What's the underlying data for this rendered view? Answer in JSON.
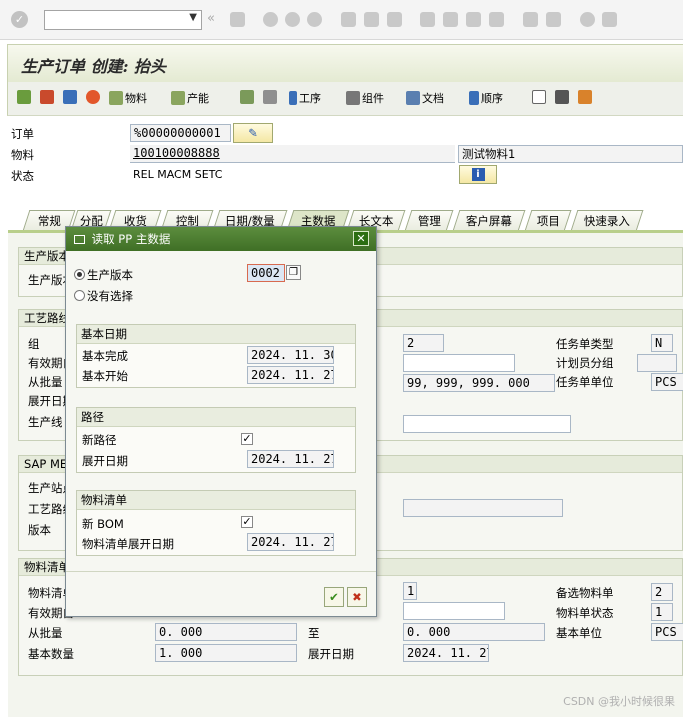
{
  "window": {
    "title": "生产订单 创建: 抬头"
  },
  "app_toolbar": {
    "material": "物料",
    "capacity": "产能",
    "operation": "工序",
    "component": "组件",
    "document": "文档",
    "sequence": "顺序"
  },
  "header": {
    "order_label": "订单",
    "order_value": "%00000000001",
    "material_label": "物料",
    "material_value": "100100008888",
    "material_desc": "测试物料1",
    "status_label": "状态",
    "status_value": "REL  MACM SETC"
  },
  "tabs": [
    "常规",
    "分配",
    "收货",
    "控制",
    "日期/数量",
    "主数据",
    "长文本",
    "管理",
    "客户屏幕",
    "项目",
    "快速录入"
  ],
  "active_tab": "主数据",
  "bg": {
    "g1_title": "生产版本",
    "g1_r1": "生产版本",
    "g2_title": "工艺路线",
    "g2_group": "组",
    "g2_valid": "有效期自",
    "g2_lot": "从批量",
    "g2_explode": "展开日期",
    "g2_prodline": "生产线",
    "g2_counter_value": "2",
    "g2_lot_to_value": "99, 999, 999. 000",
    "g2_tasklist_type": "任务单类型",
    "g2_tasklist_type_value": "N",
    "g2_planner_group": "计划员分组",
    "g2_tasklist_unit": "任务单单位",
    "g2_tasklist_unit_value": "PCS",
    "g3_title": "SAP ME",
    "g3_r1": "生产站点",
    "g3_r2": "工艺路线",
    "g3_r3": "版本",
    "g4_title": "物料清单",
    "g4_r1": "物料清单",
    "g4_r2": "有效期自",
    "g4_lot": "从批量",
    "g4_lot_value": "0. 000",
    "g4_to": "至",
    "g4_to_value": "0. 000",
    "g4_base_qty": "基本数量",
    "g4_base_qty_value": "1. 000",
    "g4_explode": "展开日期",
    "g4_explode_value": "2024. 11. 27",
    "g4_alt_value": "1",
    "g4_alt_bom": "备选物料单",
    "g4_alt_bom_value": "2",
    "g4_bom_status": "物料单状态",
    "g4_bom_status_value": "1",
    "g4_base_unit": "基本单位",
    "g4_base_unit_value": "PCS"
  },
  "dialog": {
    "title": "读取 PP 主数据",
    "radio_prod_version": "生产版本",
    "prod_version_value": "0002",
    "radio_no_selection": "没有选择",
    "basic_dates_title": "基本日期",
    "basic_finish_label": "基本完成",
    "basic_finish_value": "2024. 11. 30",
    "basic_start_label": "基本开始",
    "basic_start_value": "2024. 11. 27",
    "routing_title": "路径",
    "new_routing_label": "新路径",
    "routing_explode_label": "展开日期",
    "routing_explode_value": "2024. 11. 27",
    "bom_title": "物料清单",
    "new_bom_label": "新 BOM",
    "bom_explode_label": "物料清单展开日期",
    "bom_explode_value": "2024. 11. 27"
  },
  "watermark": "CSDN @我小时候很果"
}
